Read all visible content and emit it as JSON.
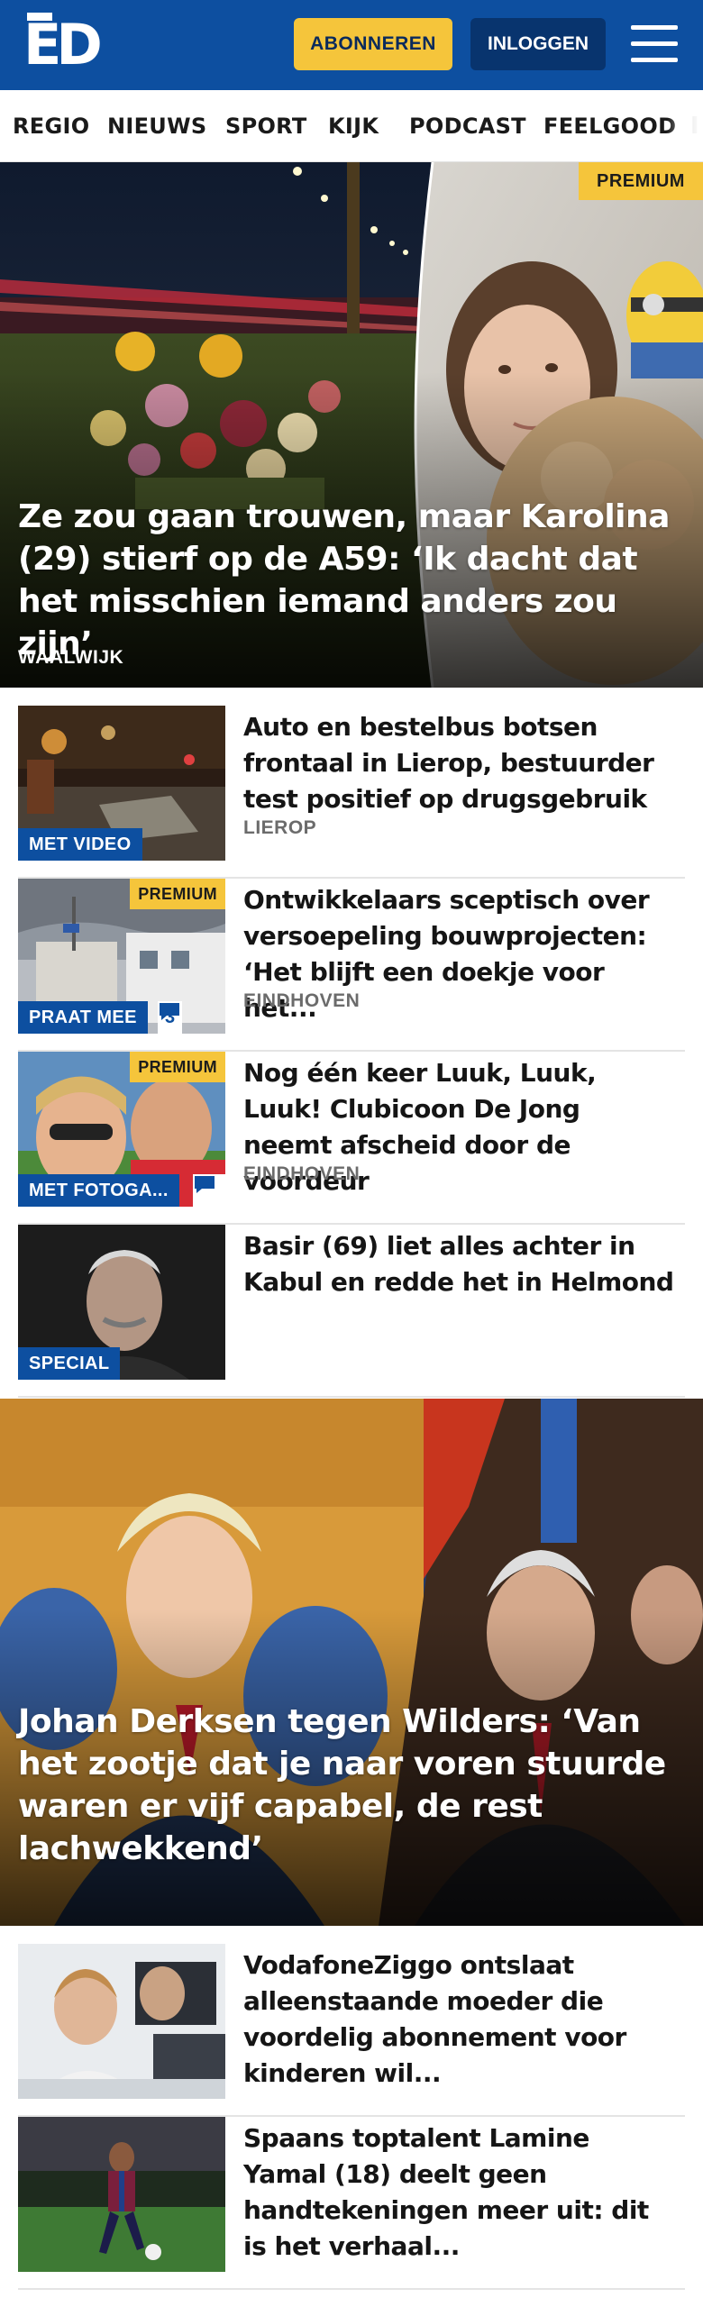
{
  "header": {
    "logo": "ED",
    "subscribe_label": "ABONNEREN",
    "login_label": "INLOGGEN"
  },
  "nav": {
    "items": [
      "REGIO",
      "NIEUWS",
      "SPORT",
      "KIJK",
      "PODCAST",
      "FEELGOOD"
    ]
  },
  "hero_top": {
    "badge": "PREMIUM",
    "title": "Ze zou gaan trouwen, maar Karolina (29) stierf op de A59: ‘Ik dacht dat het misschien iemand anders zou zijn’",
    "location": "WAALWIJK"
  },
  "articles": [
    {
      "title": "Auto en bestelbus botsen frontaal in Lierop, bestuurder test positief op drugsgebruik",
      "location": "LIEROP",
      "badge": "MET VIDEO"
    },
    {
      "title": "Ontwikkelaars sceptisch over versoepeling bouwprojecten: ‘Het blijft een doekje voor het...",
      "location": "EINDHOVEN",
      "badge": "PRAAT MEE",
      "premium": "PREMIUM",
      "comments": "3"
    },
    {
      "title": "Nog één keer Luuk, Luuk, Luuk! Clubicoon De Jong neemt afscheid door de voordeur",
      "location": "EINDHOVEN",
      "badge": "MET FOTOGA...",
      "premium": "PREMIUM"
    },
    {
      "title": "Basir (69) liet alles achter in Kabul en redde het in Helmond",
      "badge": "SPECIAL"
    }
  ],
  "hero_mid": {
    "title": "Johan Derksen tegen Wilders: ‘Van het zootje dat je naar voren stuurde waren er vijf capabel, de rest lachwek­kend’"
  },
  "articles_bottom": [
    {
      "title": "VodafoneZiggo ontslaat alleen­staande moeder die voordelig abonnement voor kinderen wil..."
    },
    {
      "title": "Spaans toptalent Lamine Yamal (18) deelt geen handtekeningen meer uit: dit is het verhaal..."
    }
  ],
  "colors": {
    "brand_blue": "#0d4fa0",
    "premium_yellow": "#f5c53b",
    "login_navy": "#08346e"
  }
}
